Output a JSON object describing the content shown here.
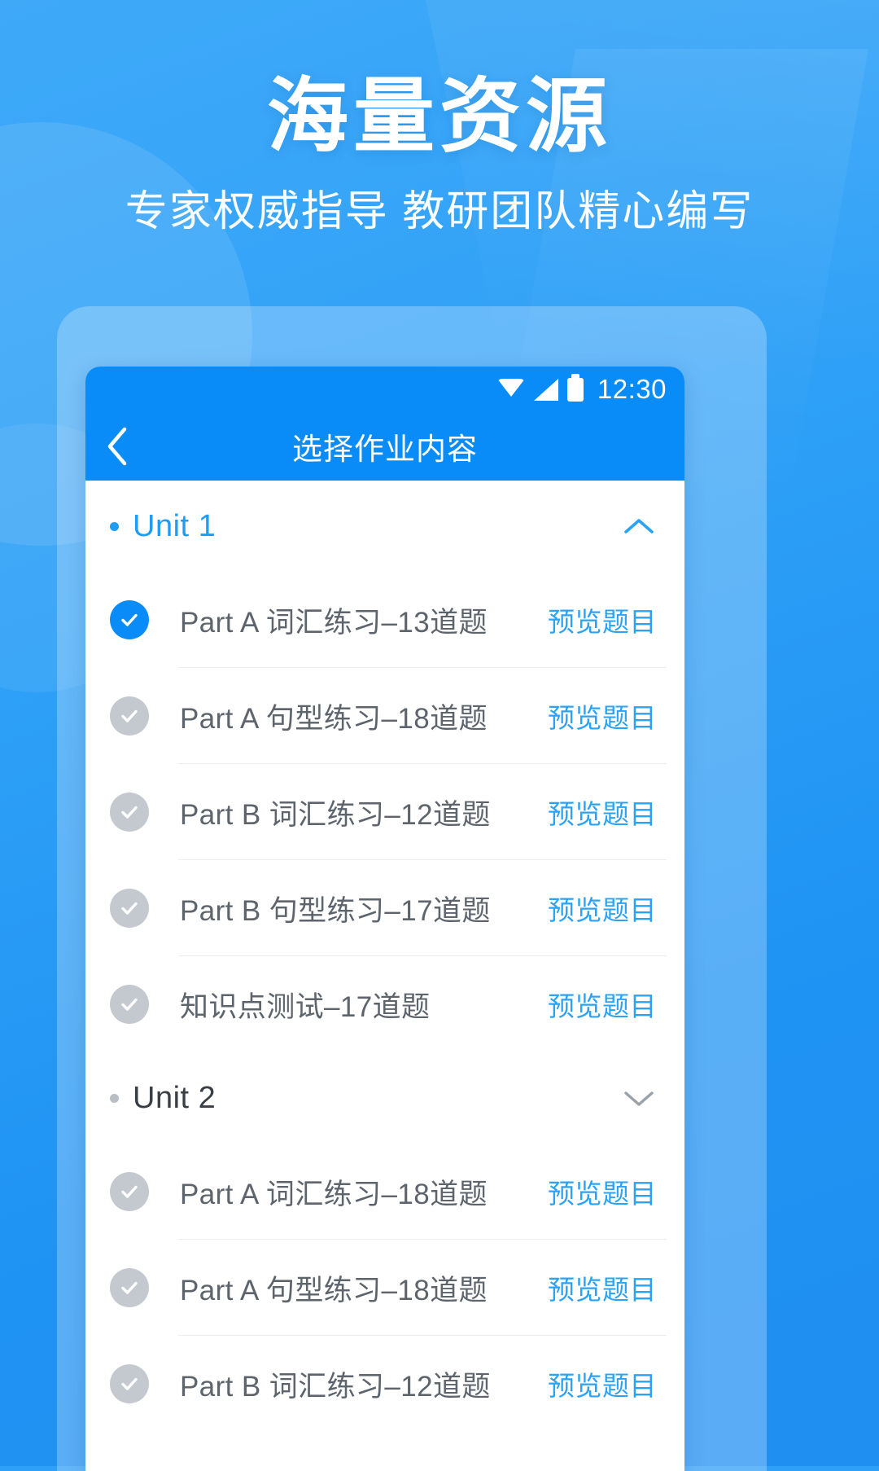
{
  "promo": {
    "title": "海量资源",
    "subtitle": "专家权威指导 教研团队精心编写"
  },
  "colors": {
    "brand_blue": "#0a8cf8",
    "accent_blue": "#1e9cf6",
    "link_blue": "#2aa3f7",
    "bg_blue": "#2ea0f7",
    "check_off_gray": "#c4c9cf",
    "text_gray": "#5d646c"
  },
  "status_bar": {
    "time": "12:30",
    "icons": [
      "wifi-icon",
      "signal-icon",
      "battery-icon"
    ]
  },
  "nav_bar": {
    "back_icon": "chevron-left-icon",
    "title": "选择作业内容"
  },
  "units": [
    {
      "label": "Unit 1",
      "expanded": true,
      "chevron_icon": "chevron-up-icon",
      "tasks": [
        {
          "label": "Part A 词汇练习–13道题",
          "checked": true,
          "preview_label": "预览题目"
        },
        {
          "label": "Part A 句型练习–18道题",
          "checked": false,
          "preview_label": "预览题目"
        },
        {
          "label": "Part B 词汇练习–12道题",
          "checked": false,
          "preview_label": "预览题目"
        },
        {
          "label": "Part B 句型练习–17道题",
          "checked": false,
          "preview_label": "预览题目"
        },
        {
          "label": "知识点测试–17道题",
          "checked": false,
          "preview_label": "预览题目"
        }
      ]
    },
    {
      "label": "Unit 2",
      "expanded": false,
      "chevron_icon": "chevron-down-icon",
      "tasks": [
        {
          "label": "Part A 词汇练习–18道题",
          "checked": false,
          "preview_label": "预览题目"
        },
        {
          "label": "Part A 句型练习–18道题",
          "checked": false,
          "preview_label": "预览题目"
        },
        {
          "label": "Part B 词汇练习–12道题",
          "checked": false,
          "preview_label": "预览题目"
        }
      ]
    }
  ]
}
